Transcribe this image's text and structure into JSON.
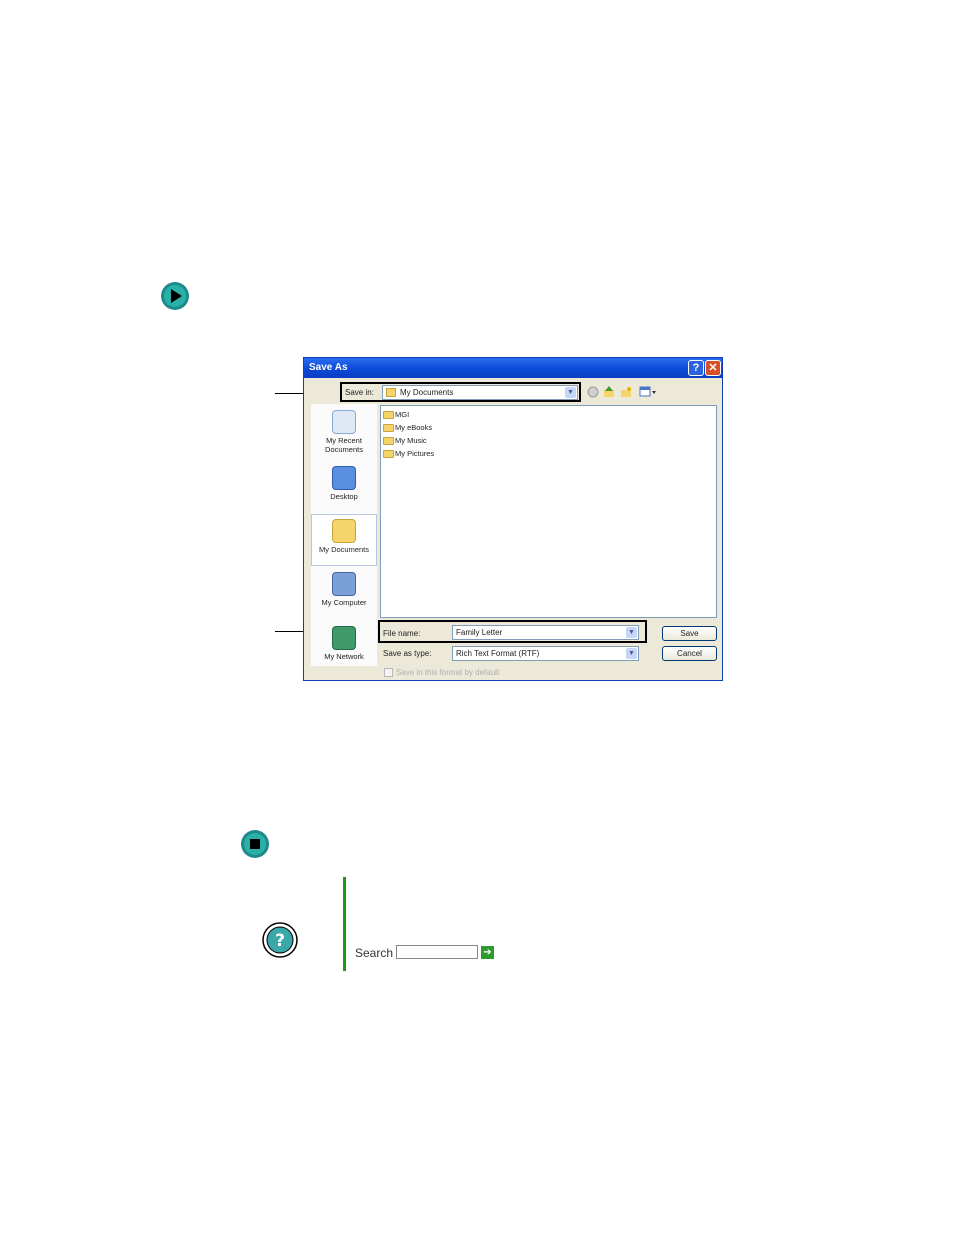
{
  "dialog": {
    "title": "Save As",
    "help_glyph": "?",
    "close_glyph": "✕",
    "save_in_label": "Save in:",
    "save_in_value": "My Documents",
    "places": [
      {
        "label": "My Recent Documents",
        "icon": "recent-documents-icon"
      },
      {
        "label": "Desktop",
        "icon": "desktop-icon"
      },
      {
        "label": "My Documents",
        "icon": "my-documents-icon"
      },
      {
        "label": "My Computer",
        "icon": "my-computer-icon"
      },
      {
        "label": "My Network",
        "icon": "my-network-icon"
      }
    ],
    "files": [
      "MGI",
      "My eBooks",
      "My Music",
      "My Pictures"
    ],
    "file_name_label": "File name:",
    "file_name_value": "Family Letter",
    "save_as_type_label": "Save as type:",
    "save_as_type_value": "Rich Text Format (RTF)",
    "save_button": "Save",
    "cancel_button": "Cancel",
    "default_format_checkbox": "Save in this format by default"
  },
  "help": {
    "search_label": "Search"
  },
  "colors": {
    "title_bar": "#0a48d6",
    "help_rule": "#1a9a1a",
    "go_arrow": "#1e8a8a"
  }
}
